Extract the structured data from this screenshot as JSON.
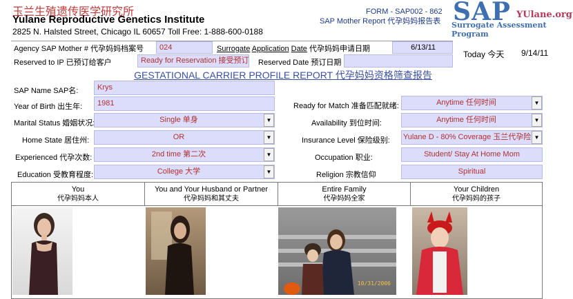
{
  "header": {
    "org_cn": "玉兰生殖遗传医学研究所",
    "org_name": "Yulane Reproductive Genetics Institute",
    "address": "2825 N. Halsted Street, Chicago IL 60657  Toll Free: 1-888-600-0188",
    "form_id": "FORM - SAP002 - 862",
    "form_title": "SAP Mother Report 代孕妈妈报告表",
    "logo_main": "SAP",
    "logo_site": "YUlane.org",
    "logo_sub": "Surrogate Assessment Program"
  },
  "top_info": {
    "agency_label": "Agency SAP Mother # 代孕妈妈档案号",
    "agency_value": "024",
    "app_date_label_1": "Surrogate",
    "app_date_label_2": "Application",
    "app_date_label_3": "Date",
    "app_date_label_cn": "代孕妈妈申请日期",
    "app_date_value": "6/13/11",
    "today_label": "Today 今天",
    "today_value": "9/14/11",
    "reserved_ip_label": "Reserved to IP 已预订给客户",
    "reserved_status": "Ready for Reservation 接受预订",
    "reserved_date_label": "Reserved Date 预订日期",
    "reserved_date_value": ""
  },
  "report_title": "GESTATIONAL CARRIER PROFILE REPORT 代孕妈妈资格筛查报告",
  "profile": {
    "name_label": "SAP Name SAP名:",
    "name_value": "Krys",
    "yob_label": "Year of Birth 出生年:",
    "yob_value": "1981",
    "marital_label": "Marital Status 婚姻状况:",
    "marital_value": "Single 单身",
    "home_state_label": "Home State 居住州:",
    "home_state_value": "OR",
    "experienced_label": "Experienced 代孕次数:",
    "experienced_value": "2nd time 第二次",
    "education_label": "Education 受教育程度:",
    "education_value": "College 大学",
    "ready_label": "Ready for Match 准备匹配就绪:",
    "ready_value": "Anytime 任何时间",
    "availability_label": "Availability 到位时间:",
    "availability_value": "Anytime 任何时间",
    "insurance_label": "Insurance Level 保险级别:",
    "insurance_value": "Yulane D - 80% Coverage 玉兰代孕险",
    "occupation_label": "Occupation 职业:",
    "occupation_value": "Student/ Stay At Home Mom",
    "religion_label": "Religion 宗教信仰",
    "religion_value": "Spiritual"
  },
  "photos": [
    {
      "title": "You",
      "title_cn": "代孕妈妈本人"
    },
    {
      "title": "You and Your Husband or Partner",
      "title_cn": "代孕妈妈和其丈夫"
    },
    {
      "title": "Entire Family",
      "title_cn": "代孕妈妈全家"
    },
    {
      "title": "Your Children",
      "title_cn": "代孕妈妈的孩子"
    }
  ],
  "photo_stamp": "10/31/2006",
  "icons": {
    "dropdown": "chevron-down-icon"
  },
  "colors": {
    "field_bg": "#dcdcfb",
    "title_blue": "#1d3a8a",
    "accent_red": "#c03a3a",
    "logo_blue": "#3f6fae"
  }
}
